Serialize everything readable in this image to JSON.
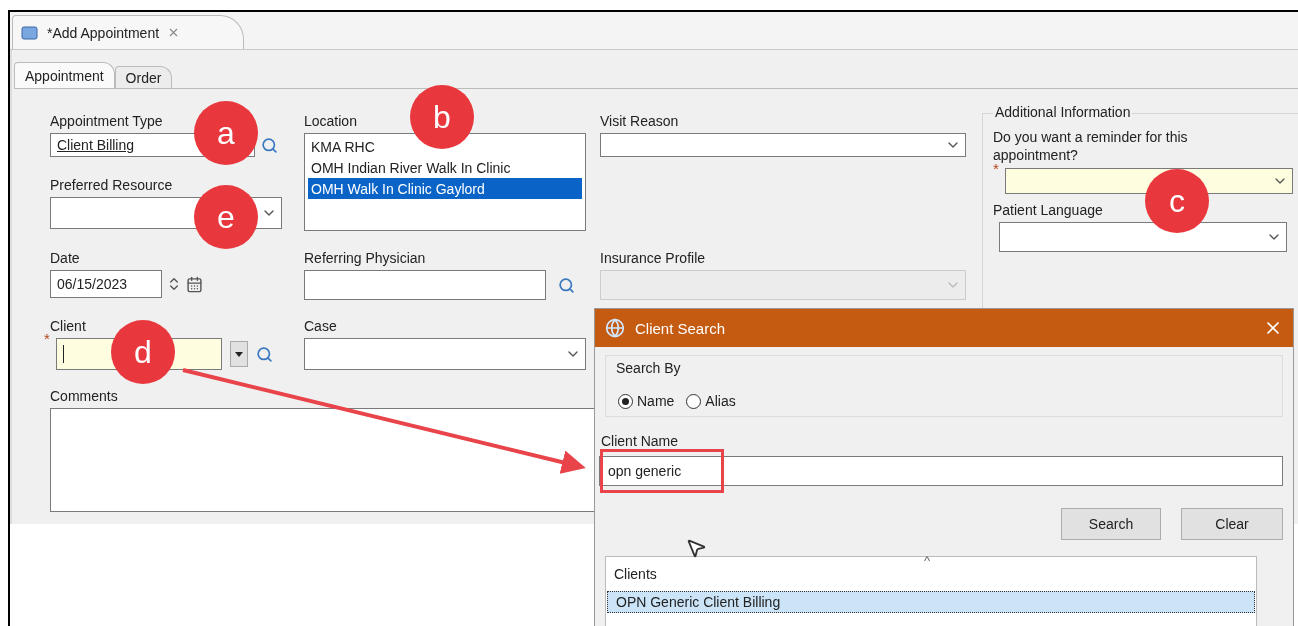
{
  "editor_tab": {
    "title": "*Add Appointment"
  },
  "tabs": [
    {
      "label": "Appointment",
      "selected": true
    },
    {
      "label": "Order",
      "selected": false
    }
  ],
  "appointment_type": {
    "label": "Appointment Type",
    "value": "Client Billing"
  },
  "preferred_resource": {
    "label": "Preferred Resource"
  },
  "date": {
    "label": "Date",
    "value": "06/15/2023"
  },
  "client": {
    "label": "Client",
    "required_mark": "*"
  },
  "comments": {
    "label": "Comments"
  },
  "location": {
    "label": "Location",
    "items": [
      {
        "label": "KMA RHC",
        "selected": false
      },
      {
        "label": "OMH Indian River Walk In Clinic",
        "selected": false
      },
      {
        "label": "OMH Walk In Clinic Gaylord",
        "selected": true
      }
    ]
  },
  "referring_physician": {
    "label": "Referring Physician"
  },
  "case": {
    "label": "Case"
  },
  "visit_reason": {
    "label": "Visit Reason"
  },
  "insurance_profile": {
    "label": "Insurance Profile",
    "disabled": true
  },
  "additional_information": {
    "title": "Additional Information",
    "reminder": {
      "label": "Do you want a reminder for this appointment?",
      "required_mark": "*"
    },
    "patient_language": {
      "label": "Patient Language"
    }
  },
  "client_search": {
    "title": "Client Search",
    "search_by": {
      "label": "Search By",
      "options": [
        {
          "label": "Name",
          "selected": true
        },
        {
          "label": "Alias",
          "selected": false
        }
      ]
    },
    "client_name": {
      "label": "Client Name",
      "value": "opn generic"
    },
    "buttons": [
      "Search",
      "Clear"
    ],
    "clients": {
      "header": "Clients",
      "sort_mark": "^",
      "rows": [
        {
          "label": "OPN Generic Client Billing",
          "selected": true
        }
      ]
    }
  },
  "callouts": [
    {
      "letter": "a"
    },
    {
      "letter": "b"
    },
    {
      "letter": "c"
    },
    {
      "letter": "d"
    },
    {
      "letter": "e"
    }
  ]
}
